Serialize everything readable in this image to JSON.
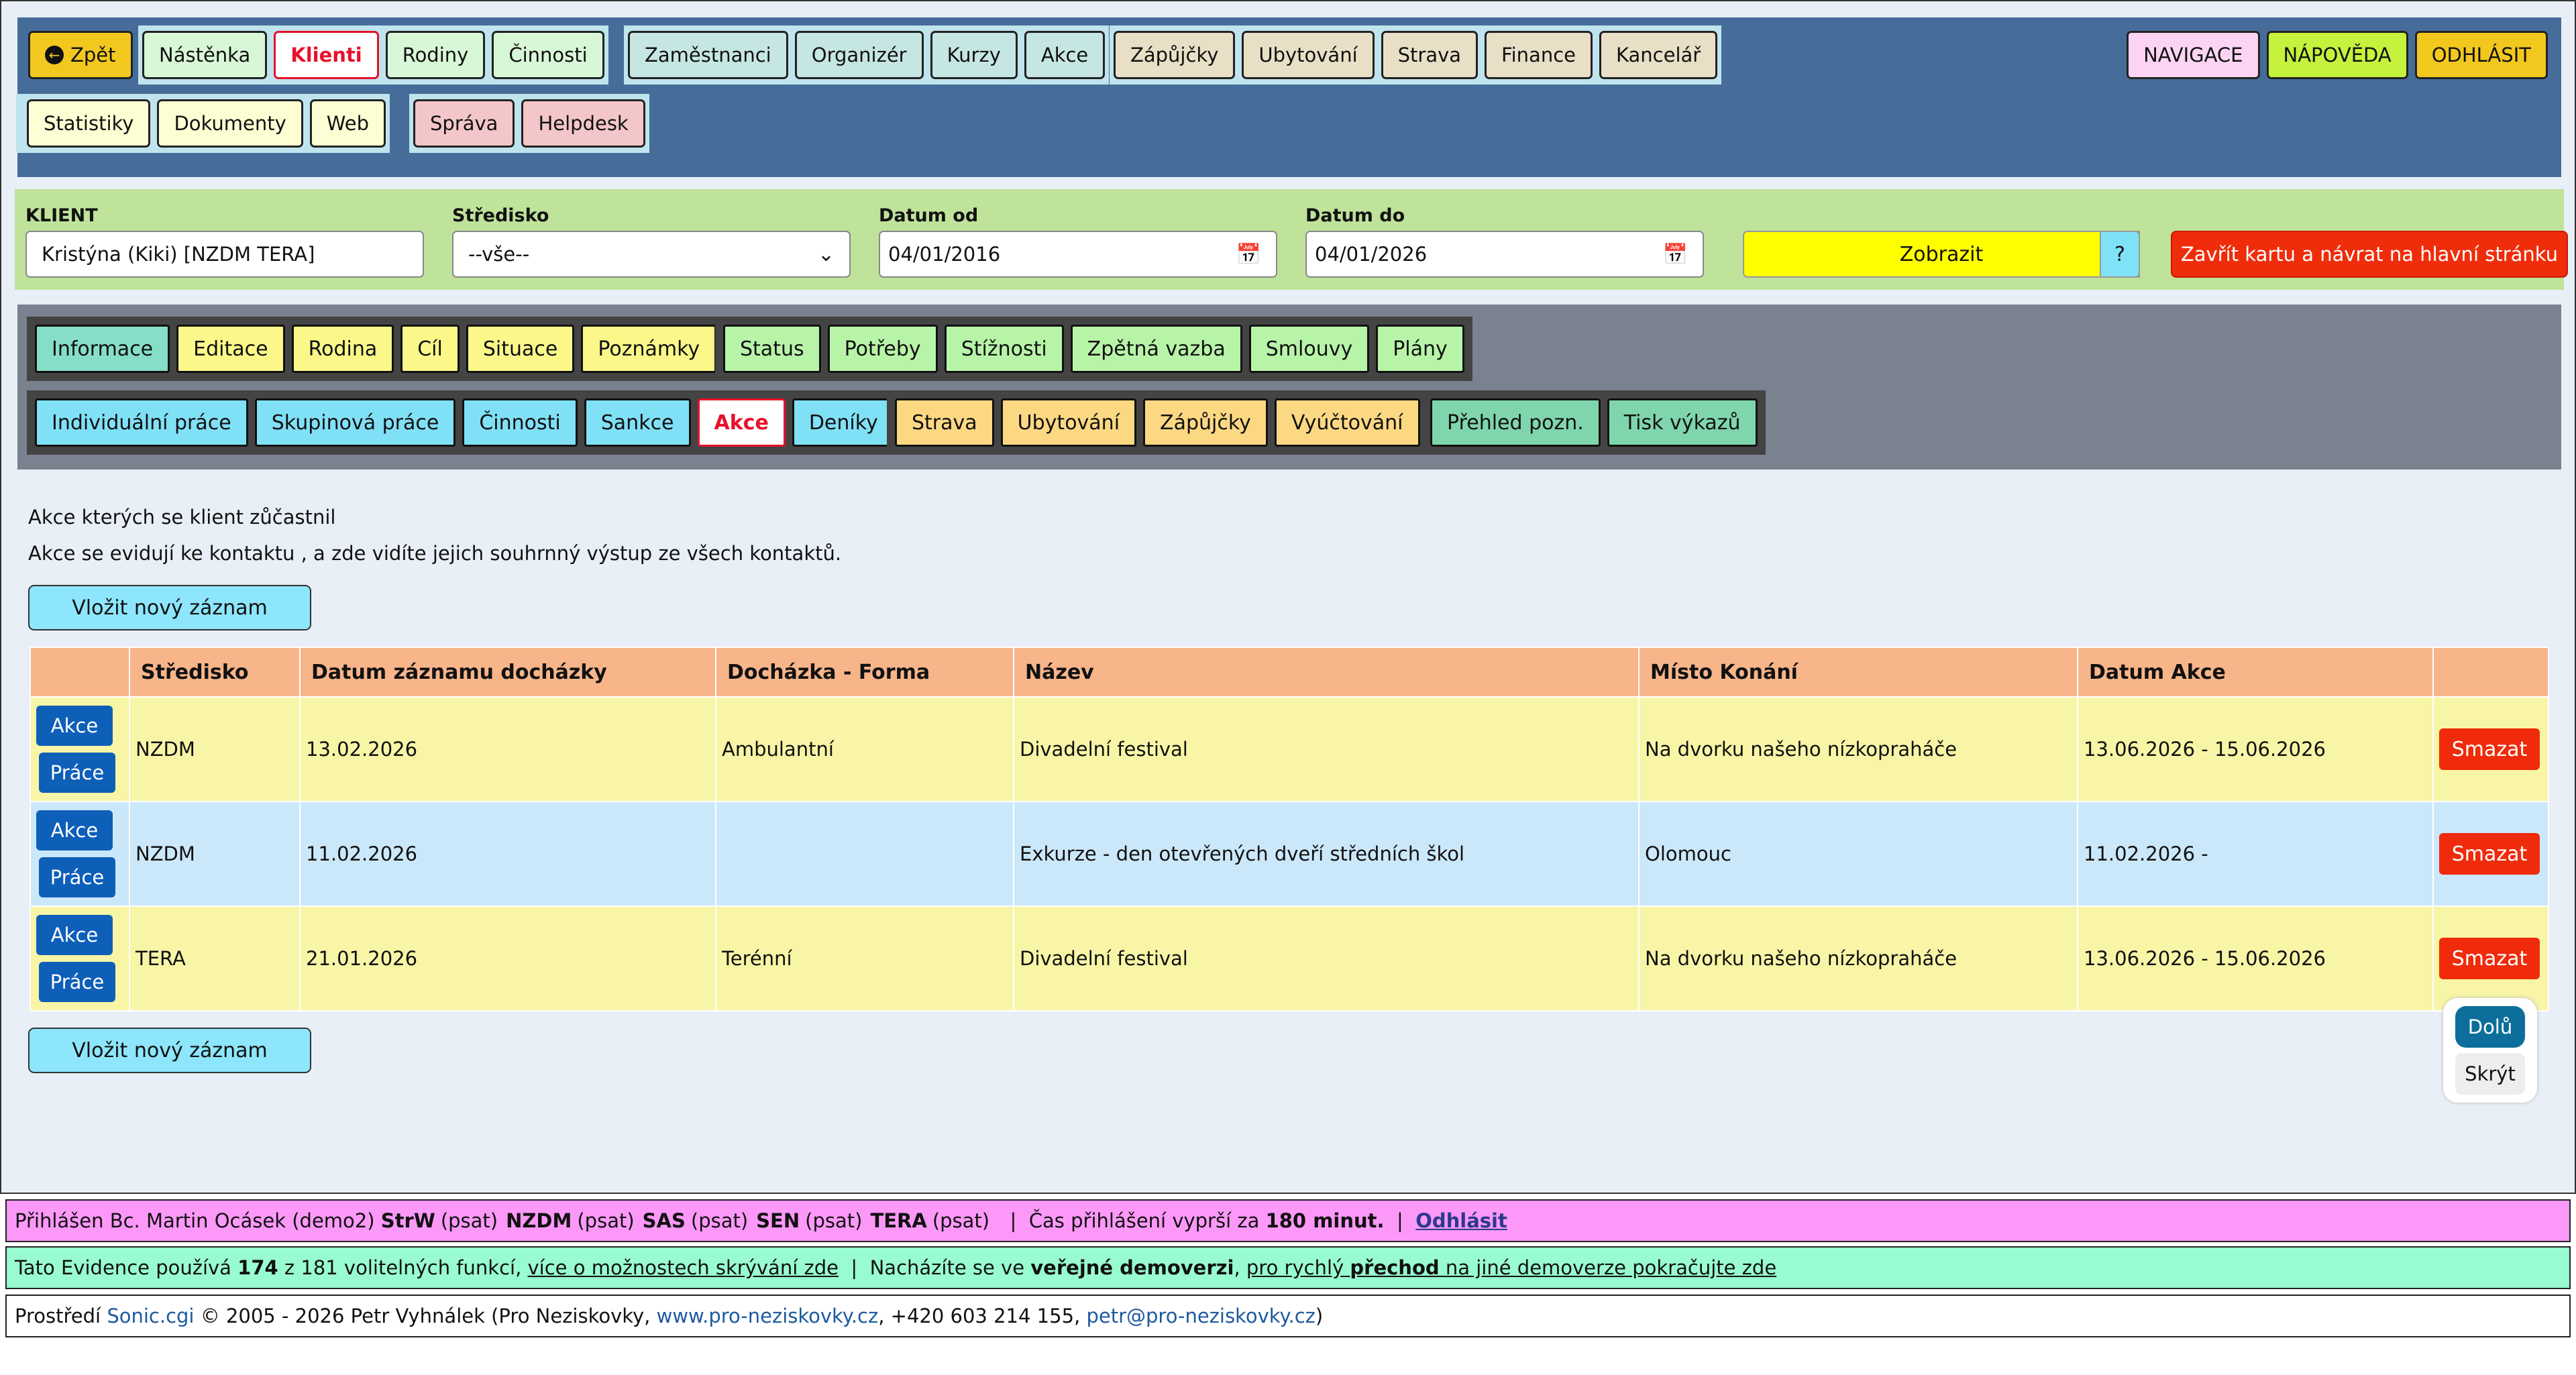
{
  "topnav": {
    "back": "Zpět",
    "group1": [
      "Nástěnka",
      "Klienti",
      "Rodiny",
      "Činnosti"
    ],
    "group2": [
      "Zaměstnanci",
      "Organizér",
      "Kurzy",
      "Akce"
    ],
    "group3": [
      "Zápůjčky",
      "Ubytování",
      "Strava",
      "Finance",
      "Kancelář"
    ],
    "group4": [
      "Statistiky",
      "Dokumenty",
      "Web"
    ],
    "group5": [
      "Správa",
      "Helpdesk"
    ],
    "right": [
      "NAVIGACE",
      "NÁPOVĚDA",
      "ODHLÁSIT"
    ],
    "active": "Klienti"
  },
  "filter": {
    "client_label": "KLIENT",
    "client_value": "Kristýna (Kiki) [NZDM TERA]",
    "center_label": "Středisko",
    "center_value": "--vše--",
    "from_label": "Datum od",
    "from_value": "04/01/2016",
    "to_label": "Datum do",
    "to_value": "04/01/2026",
    "show": "Zobrazit",
    "help": "?",
    "close": "Zavřít kartu a návrat na hlavní stránku"
  },
  "subnav": {
    "row1a": [
      "Informace",
      "Editace",
      "Rodina",
      "Cíl",
      "Situace",
      "Poznámky"
    ],
    "row1b": [
      "Status",
      "Potřeby",
      "Stížnosti",
      "Zpětná vazba",
      "Smlouvy",
      "Plány"
    ],
    "row2a": [
      "Individuální práce",
      "Skupinová práce",
      "Činnosti",
      "Sankce",
      "Akce",
      "Deníky"
    ],
    "row2b": [
      "Strava",
      "Ubytování",
      "Zápůjčky",
      "Vyúčtování"
    ],
    "row2c": [
      "Přehled pozn.",
      "Tisk výkazů"
    ],
    "active": "Akce"
  },
  "content": {
    "intro1": "Akce kterých se klient zůčastnil",
    "intro2": "Akce se evidují ke kontaktu , a zde vidíte jejich souhrnný výstup ze všech kontaktů.",
    "add": "Vložit nový záznam",
    "columns": [
      "",
      "Středisko",
      "Datum záznamu docházky",
      "Docházka - Forma",
      "Název",
      "Místo Konání",
      "Datum Akce",
      ""
    ],
    "row_buttons": [
      "Akce",
      "Práce"
    ],
    "delete": "Smazat",
    "rows": [
      {
        "center": "NZDM",
        "date": "13.02.2026",
        "form": "Ambulantní",
        "name": "Divadelní festival",
        "place": "Na dvorku našeho nízkopraháče",
        "event": "13.06.2026 - 15.06.2026"
      },
      {
        "center": "NZDM",
        "date": "11.02.2026",
        "form": "",
        "name": "Exkurze - den otevřených dveří středních škol",
        "place": "Olomouc",
        "event": "11.02.2026 -"
      },
      {
        "center": "TERA",
        "date": "21.01.2026",
        "form": "Terénní",
        "name": "Divadelní festival",
        "place": "Na dvorku našeho nízkopraháče",
        "event": "13.06.2026 - 15.06.2026"
      }
    ],
    "down": "Dolů",
    "hide": "Skrýt"
  },
  "footer": {
    "login_prefix": "Přihlášen Bc. Martin Ocásek (demo2)",
    "roles": [
      {
        "code": "StrW",
        "mode": "(psat)"
      },
      {
        "code": "NZDM",
        "mode": "(psat)"
      },
      {
        "code": "SAS",
        "mode": "(psat)"
      },
      {
        "code": "SEN",
        "mode": "(psat)"
      },
      {
        "code": "TERA",
        "mode": "(psat)"
      }
    ],
    "sep": "|",
    "expire_prefix": "Čas přihlášení vyprší za",
    "expire_value": "180 minut.",
    "logout": "Odhlásit",
    "features_prefix": "Tato Evidence používá",
    "features_count": "174",
    "features_suffix": "z 181 volitelných funkcí,",
    "features_link": "více o možnostech skrývání zde",
    "demo_prefix": "Nacházíte se ve",
    "demo_bold": "veřejné demoverzi",
    "demo_link_a": "pro rychlý",
    "demo_link_bold": "přechod",
    "demo_link_b": "na jiné demoverze pokračujte zde",
    "env_prefix": "Prostředí",
    "env_name": "Sonic.cgi",
    "copyright": "© 2005 - 2026 Petr Vyhnálek (Pro Neziskovky,",
    "website": "www.pro-neziskovky.cz",
    "phone": ", +420 603 214 155,",
    "email": "petr@pro-neziskovky.cz",
    "close_paren": ")"
  },
  "colors": {
    "nav_bg": "#466d99",
    "filter_bg": "#bfe39a",
    "subnav_bg": "#7a8290",
    "accent_red": "#e8102b",
    "header_orange": "#f8b58a"
  }
}
